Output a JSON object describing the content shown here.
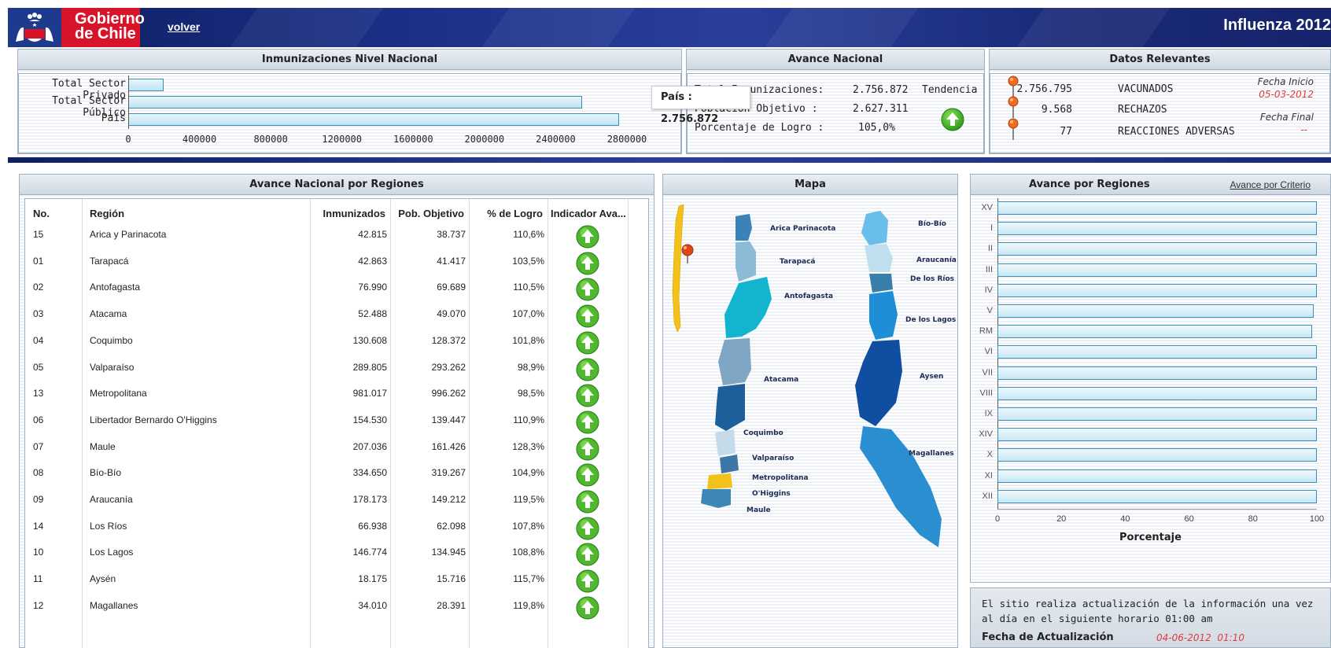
{
  "header": {
    "logo_text_line1": "Gobierno",
    "logo_text_line2": "de Chile",
    "back_link": "volver",
    "app_title": "Influenza 2012"
  },
  "inmunizaciones": {
    "title": "Inmunizaciones Nivel Nacional",
    "rows": [
      {
        "label": "Total Sector Privado",
        "value": 200000
      },
      {
        "label": "Total Sector Público",
        "value": 2550000
      },
      {
        "label": "País",
        "value": 2756872
      }
    ],
    "ticks": [
      "0",
      "400000",
      "800000",
      "1200000",
      "1600000",
      "2000000",
      "2400000",
      "2800000"
    ],
    "xmax": 2800000,
    "tooltip": "País : 2.756.872"
  },
  "avance_nacional": {
    "title": "Avance Nacional",
    "rows": [
      {
        "label": "Total Inmunizaciones:",
        "value": "2.756.872"
      },
      {
        "label": "Población Objetivo   :",
        "value": "2.627.311"
      },
      {
        "label": "Porcentaje de Logro  :",
        "value": "105,0%"
      }
    ],
    "tendencia_label": "Tendencia",
    "icon": "arrow-up-icon"
  },
  "datos_relevantes": {
    "title": "Datos Relevantes",
    "items": [
      {
        "value": "2.756.795",
        "label": "VACUNADOS"
      },
      {
        "value": "9.568",
        "label": "RECHAZOS"
      },
      {
        "value": "77",
        "label": "REACCIONES ADVERSAS"
      }
    ],
    "fecha_inicio_label": "Fecha Inicio",
    "fecha_inicio": "05-03-2012",
    "fecha_final_label": "Fecha Final",
    "fecha_final": "--"
  },
  "regiones_table": {
    "title": "Avance Nacional por Regiones",
    "columns": [
      "No.",
      "Región",
      "Inmunizados",
      "Pob. Objetivo",
      "% de Logro",
      "Indicador Ava..."
    ],
    "rows": [
      {
        "no": "15",
        "region": "Arica y Parinacota",
        "inmunizados": "42.815",
        "objetivo": "38.737",
        "logro": "110,6%"
      },
      {
        "no": "01",
        "region": "Tarapacá",
        "inmunizados": "42.863",
        "objetivo": "41.417",
        "logro": "103,5%"
      },
      {
        "no": "02",
        "region": "Antofagasta",
        "inmunizados": "76.990",
        "objetivo": "69.689",
        "logro": "110,5%"
      },
      {
        "no": "03",
        "region": "Atacama",
        "inmunizados": "52.488",
        "objetivo": "49.070",
        "logro": "107,0%"
      },
      {
        "no": "04",
        "region": "Coquimbo",
        "inmunizados": "130.608",
        "objetivo": "128.372",
        "logro": "101,8%"
      },
      {
        "no": "05",
        "region": "Valparaíso",
        "inmunizados": "289.805",
        "objetivo": "293.262",
        "logro": "98,9%"
      },
      {
        "no": "13",
        "region": "Metropolitana",
        "inmunizados": "981.017",
        "objetivo": "996.262",
        "logro": "98,5%"
      },
      {
        "no": "06",
        "region": "Libertador Bernardo O'Higgins",
        "inmunizados": "154.530",
        "objetivo": "139.447",
        "logro": "110,9%"
      },
      {
        "no": "07",
        "region": "Maule",
        "inmunizados": "207.036",
        "objetivo": "161.426",
        "logro": "128,3%"
      },
      {
        "no": "08",
        "region": "Bío-Bío",
        "inmunizados": "334.650",
        "objetivo": "319.267",
        "logro": "104,9%"
      },
      {
        "no": "09",
        "region": "Araucanía",
        "inmunizados": "178.173",
        "objetivo": "149.212",
        "logro": "119,5%"
      },
      {
        "no": "14",
        "region": "Los Ríos",
        "inmunizados": "66.938",
        "objetivo": "62.098",
        "logro": "107,8%"
      },
      {
        "no": "10",
        "region": "Los Lagos",
        "inmunizados": "146.774",
        "objetivo": "134.945",
        "logro": "108,8%"
      },
      {
        "no": "11",
        "region": "Aysén",
        "inmunizados": "18.175",
        "objetivo": "15.716",
        "logro": "115,7%"
      },
      {
        "no": "12",
        "region": "Magallanes",
        "inmunizados": "34.010",
        "objetivo": "28.391",
        "logro": "119,8%"
      }
    ]
  },
  "mapa": {
    "title": "Mapa",
    "labels_left": [
      "Arica Parinacota",
      "Tarapacá",
      "Antofagasta",
      "Atacama",
      "Coquimbo",
      "Valparaíso",
      "Metropolitana",
      "O'Higgins",
      "Maule"
    ],
    "labels_right": [
      "Bío-Bío",
      "Araucanía",
      "De los Ríos",
      "De los Lagos",
      "Aysen",
      "Magallanes"
    ]
  },
  "avance_regiones": {
    "title": "Avance por Regiones",
    "link": "Avance por Criterio",
    "categories": [
      "XV",
      "I",
      "II",
      "III",
      "IV",
      "V",
      "RM",
      "VI",
      "VII",
      "VIII",
      "IX",
      "XIV",
      "X",
      "XI",
      "XII"
    ],
    "values": [
      100,
      100,
      100,
      100,
      100,
      98.9,
      98.5,
      100,
      100,
      100,
      100,
      100,
      100,
      100,
      100
    ],
    "ticks": [
      "0",
      "20",
      "40",
      "60",
      "80",
      "100"
    ],
    "xlabel": "Porcentaje"
  },
  "info": {
    "text": "El sitio realiza actualización de la información una vez al día en el siguiente horario 01:00 am",
    "fecha_label": "Fecha de Actualización",
    "fecha_value": "04-06-2012  01:10"
  },
  "colors": {
    "header_navy": "#1b2f86",
    "brand_red": "#d8142b",
    "date_red": "#e23b3b",
    "bar_border": "#3d8db5"
  }
}
